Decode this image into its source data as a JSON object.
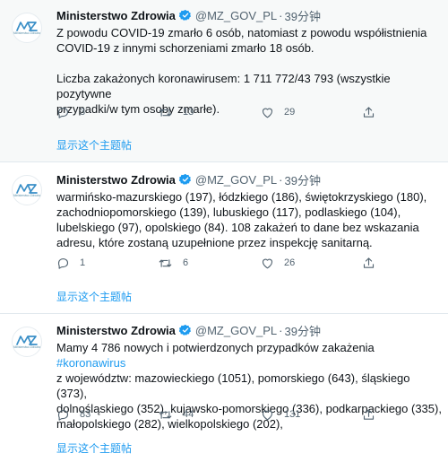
{
  "tweets": [
    {
      "author": "Ministerstwo Zdrowia",
      "handle": "@MZ_GOV_PL",
      "dot": "·",
      "time": "39分钟",
      "avatar_caption": "Ministerstwo Zdrowia",
      "body": [
        [
          {
            "t": "Z powodu COVID-19 zmarło 6 osób, natomiast z powodu współistnienia"
          }
        ],
        [
          {
            "t": "COVID-19 z innymi schorzeniami zmarło 18 osób."
          }
        ],
        [],
        [
          {
            "t": "Liczba zakażonych koronawirusem: 1 711 772/43 793 (wszystkie pozytywne"
          }
        ],
        [
          {
            "t": "przypadki/w tym osoby zmarłe)."
          }
        ]
      ],
      "replies": "3",
      "retweets": "13",
      "likes": "29",
      "show_thread": "显示这个主题帖"
    },
    {
      "author": "Ministerstwo Zdrowia",
      "handle": "@MZ_GOV_PL",
      "dot": "·",
      "time": "39分钟",
      "avatar_caption": "Ministerstwo Zdrowia",
      "body": [
        [
          {
            "t": "warmińsko-mazurskiego (197), łódzkiego (186), świętokrzyskiego (180),"
          }
        ],
        [
          {
            "t": "zachodniopomorskiego (139), lubuskiego (117), podlaskiego (104),"
          }
        ],
        [
          {
            "t": "lubelskiego (97), opolskiego (84). 108 zakażeń to dane bez wskazania"
          }
        ],
        [
          {
            "t": "adresu, które zostaną uzupełnione przez inspekcję sanitarną."
          }
        ]
      ],
      "replies": "1",
      "retweets": "6",
      "likes": "26",
      "show_thread": "显示这个主题帖"
    },
    {
      "author": "Ministerstwo Zdrowia",
      "handle": "@MZ_GOV_PL",
      "dot": "·",
      "time": "39分钟",
      "avatar_caption": "Ministerstwo Zdrowia",
      "body": [
        [
          {
            "t": "Mamy 4 786 nowych i potwierdzonych przypadków zakażenia "
          },
          {
            "t": "#koronawirus",
            "tag": true
          }
        ],
        [
          {
            "t": "z województw: mazowieckiego (1051), pomorskiego (643), śląskiego (373),"
          }
        ],
        [
          {
            "t": "dolnośląskiego (352), kujawsko-pomorskiego (336), podkarpackiego (335),"
          }
        ],
        [
          {
            "t": "małopolskiego (282), wielkopolskiego (202),"
          }
        ]
      ],
      "replies": "83",
      "retweets": "44",
      "likes": "131",
      "show_thread": "显示这个主题帖"
    }
  ],
  "colors": {
    "link": "#1d9bf0",
    "muted": "#536471",
    "verified": "#1d9bf0",
    "divider": "#e1e8ed",
    "shaded_bg": "#f7f9f9"
  },
  "icons": [
    "verified-badge-icon",
    "reply-icon",
    "retweet-icon",
    "like-icon",
    "share-icon",
    "mz-logo"
  ]
}
